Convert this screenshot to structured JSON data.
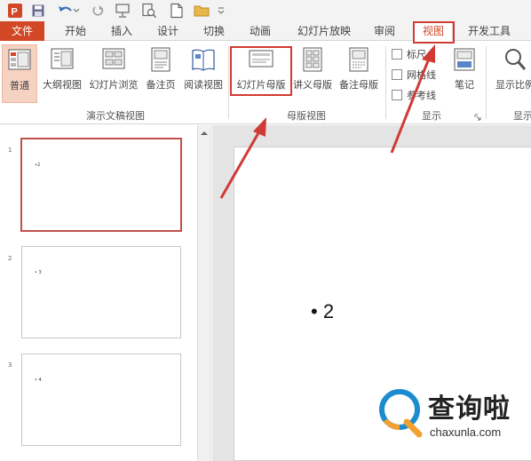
{
  "tabs": {
    "file": "文件",
    "home": "开始",
    "insert": "插入",
    "design": "设计",
    "transitions": "切换",
    "animations": "动画",
    "slideshow": "幻灯片放映",
    "review": "审阅",
    "view": "视图",
    "developer": "开发工具"
  },
  "ribbon": {
    "presentation_views": {
      "normal": "普通",
      "outline": "大纲视图",
      "sorter": "幻灯片浏览",
      "notes_page": "备注页",
      "reading": "阅读视图",
      "group_label": "演示文稿视图"
    },
    "master_views": {
      "slide_master": "幻灯片母版",
      "handout_master": "讲义母版",
      "notes_master": "备注母版",
      "group_label": "母版视图"
    },
    "show": {
      "ruler": "标尺",
      "gridlines": "网格线",
      "guides": "参考线",
      "notes": "笔记",
      "group_label": "显示"
    },
    "zoom": {
      "zoom_label": "显示比例",
      "group_label": "显示"
    }
  },
  "slides": [
    {
      "number": "1",
      "text": "•2"
    },
    {
      "number": "2",
      "text": "• 3"
    },
    {
      "number": "3",
      "text": "• 4"
    }
  ],
  "main_slide": {
    "text": "• 2"
  },
  "watermark": {
    "brand": "查询啦",
    "url": "chaxunla.com"
  },
  "colors": {
    "accent": "#d24726",
    "highlight_red": "#d03a35",
    "selected_thumb": "#c0504d",
    "brand_blue": "#1a8ccf",
    "brand_orange": "#f2a030"
  },
  "icons": [
    "app-logo-icon",
    "save-icon",
    "undo-icon",
    "redo-icon",
    "present-icon",
    "preview-icon",
    "new-icon",
    "open-icon",
    "magnifier-icon"
  ]
}
